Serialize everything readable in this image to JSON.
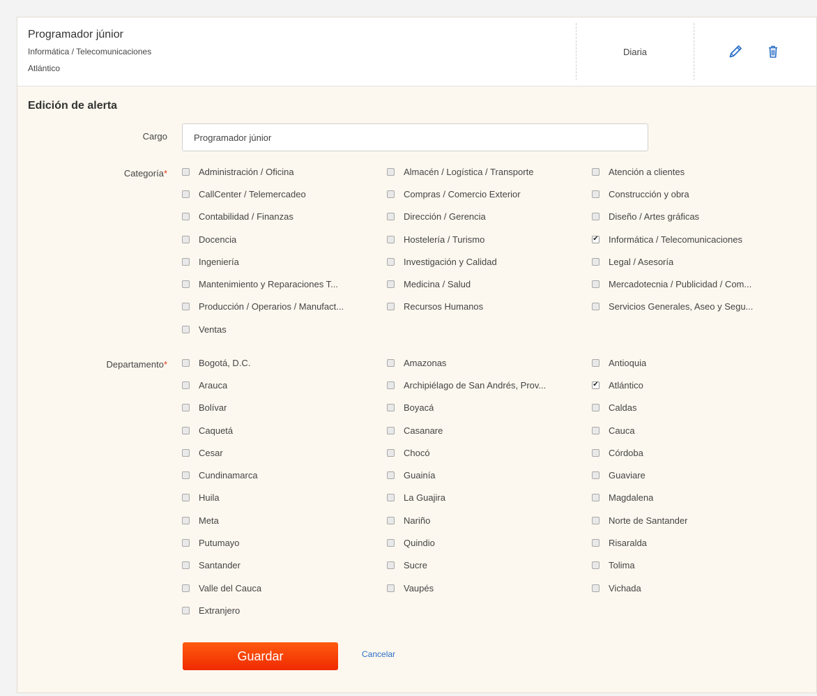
{
  "summary": {
    "title": "Programador júnior",
    "category": "Informática / Telecomunicaciones",
    "location": "Atlántico",
    "frequency": "Diaria"
  },
  "icons": {
    "edit": "pencil-icon",
    "delete": "trash-icon"
  },
  "colors": {
    "accent": "#2a6fc7",
    "primary_button": "#f8430a",
    "required": "#e23b1c",
    "panel": "#fdf8ef"
  },
  "form": {
    "title": "Edición de alerta",
    "cargo_label": "Cargo",
    "cargo_value": "Programador júnior",
    "categoria_label": "Categoría",
    "departamento_label": "Departamento",
    "required_mark": "*",
    "save_label": "Guardar",
    "cancel_label": "Cancelar"
  },
  "categories": [
    {
      "label": "Administración / Oficina",
      "checked": false
    },
    {
      "label": "Almacén / Logística / Transporte",
      "checked": false
    },
    {
      "label": "Atención a clientes",
      "checked": false
    },
    {
      "label": "CallCenter / Telemercadeo",
      "checked": false
    },
    {
      "label": "Compras / Comercio Exterior",
      "checked": false
    },
    {
      "label": "Construcción y obra",
      "checked": false
    },
    {
      "label": "Contabilidad / Finanzas",
      "checked": false
    },
    {
      "label": "Dirección / Gerencia",
      "checked": false
    },
    {
      "label": "Diseño / Artes gráficas",
      "checked": false
    },
    {
      "label": "Docencia",
      "checked": false
    },
    {
      "label": "Hostelería / Turismo",
      "checked": false
    },
    {
      "label": "Informática / Telecomunicaciones",
      "checked": true
    },
    {
      "label": "Ingeniería",
      "checked": false
    },
    {
      "label": "Investigación y Calidad",
      "checked": false
    },
    {
      "label": "Legal / Asesoría",
      "checked": false
    },
    {
      "label": "Mantenimiento y Reparaciones T...",
      "checked": false
    },
    {
      "label": "Medicina / Salud",
      "checked": false
    },
    {
      "label": "Mercadotecnia / Publicidad / Com...",
      "checked": false
    },
    {
      "label": "Producción / Operarios / Manufact...",
      "checked": false
    },
    {
      "label": "Recursos Humanos",
      "checked": false
    },
    {
      "label": "Servicios Generales, Aseo y Segu...",
      "checked": false
    },
    {
      "label": "Ventas",
      "checked": false
    }
  ],
  "departments": [
    {
      "label": "Bogotá, D.C.",
      "checked": false
    },
    {
      "label": "Amazonas",
      "checked": false
    },
    {
      "label": "Antioquia",
      "checked": false
    },
    {
      "label": "Arauca",
      "checked": false
    },
    {
      "label": "Archipiélago de San Andrés, Prov...",
      "checked": false
    },
    {
      "label": "Atlántico",
      "checked": true
    },
    {
      "label": "Bolívar",
      "checked": false
    },
    {
      "label": "Boyacá",
      "checked": false
    },
    {
      "label": "Caldas",
      "checked": false
    },
    {
      "label": "Caquetá",
      "checked": false
    },
    {
      "label": "Casanare",
      "checked": false
    },
    {
      "label": "Cauca",
      "checked": false
    },
    {
      "label": "Cesar",
      "checked": false
    },
    {
      "label": "Chocó",
      "checked": false
    },
    {
      "label": "Córdoba",
      "checked": false
    },
    {
      "label": "Cundinamarca",
      "checked": false
    },
    {
      "label": "Guainía",
      "checked": false
    },
    {
      "label": "Guaviare",
      "checked": false
    },
    {
      "label": "Huila",
      "checked": false
    },
    {
      "label": "La Guajira",
      "checked": false
    },
    {
      "label": "Magdalena",
      "checked": false
    },
    {
      "label": "Meta",
      "checked": false
    },
    {
      "label": "Nariño",
      "checked": false
    },
    {
      "label": "Norte de Santander",
      "checked": false
    },
    {
      "label": "Putumayo",
      "checked": false
    },
    {
      "label": "Quindio",
      "checked": false
    },
    {
      "label": "Risaralda",
      "checked": false
    },
    {
      "label": "Santander",
      "checked": false
    },
    {
      "label": "Sucre",
      "checked": false
    },
    {
      "label": "Tolima",
      "checked": false
    },
    {
      "label": "Valle del Cauca",
      "checked": false
    },
    {
      "label": "Vaupés",
      "checked": false
    },
    {
      "label": "Vichada",
      "checked": false
    },
    {
      "label": "Extranjero",
      "checked": false
    }
  ]
}
